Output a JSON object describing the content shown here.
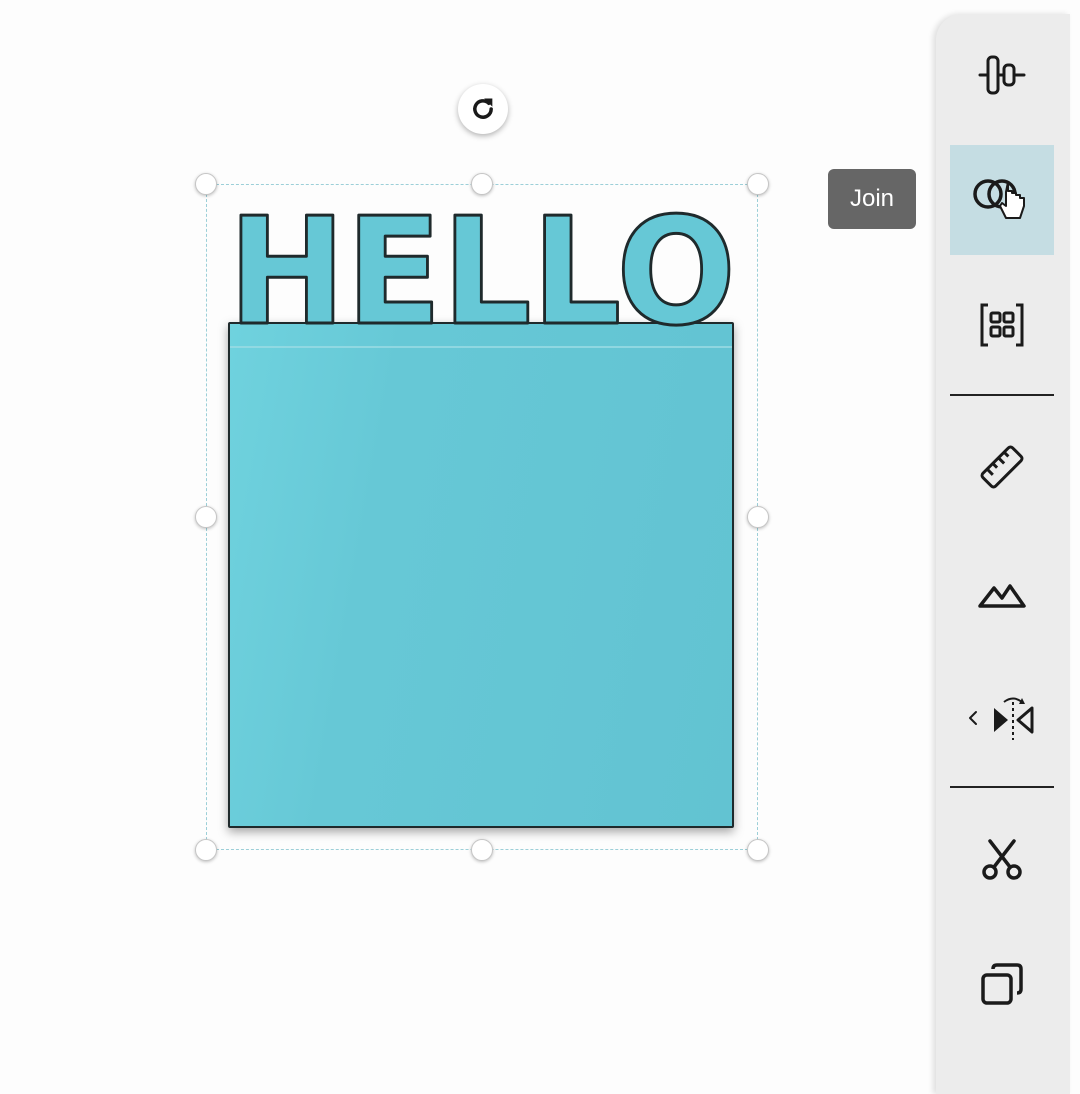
{
  "canvas": {
    "design_text": "HELLO",
    "fill_color": "#66c8d6",
    "stroke_color": "#1f2a2c",
    "selection_color": "#9ccfd8"
  },
  "toolbar": {
    "items": [
      {
        "name": "align-icon"
      },
      {
        "name": "join-icon",
        "active": true
      },
      {
        "name": "group-icon"
      },
      {
        "name": "ruler-icon"
      },
      {
        "name": "image-icon"
      },
      {
        "name": "flip-icon"
      },
      {
        "name": "scissors-icon"
      },
      {
        "name": "duplicate-icon"
      }
    ],
    "active_bg": "#c5dde3"
  },
  "tooltip": {
    "label": "Join"
  }
}
